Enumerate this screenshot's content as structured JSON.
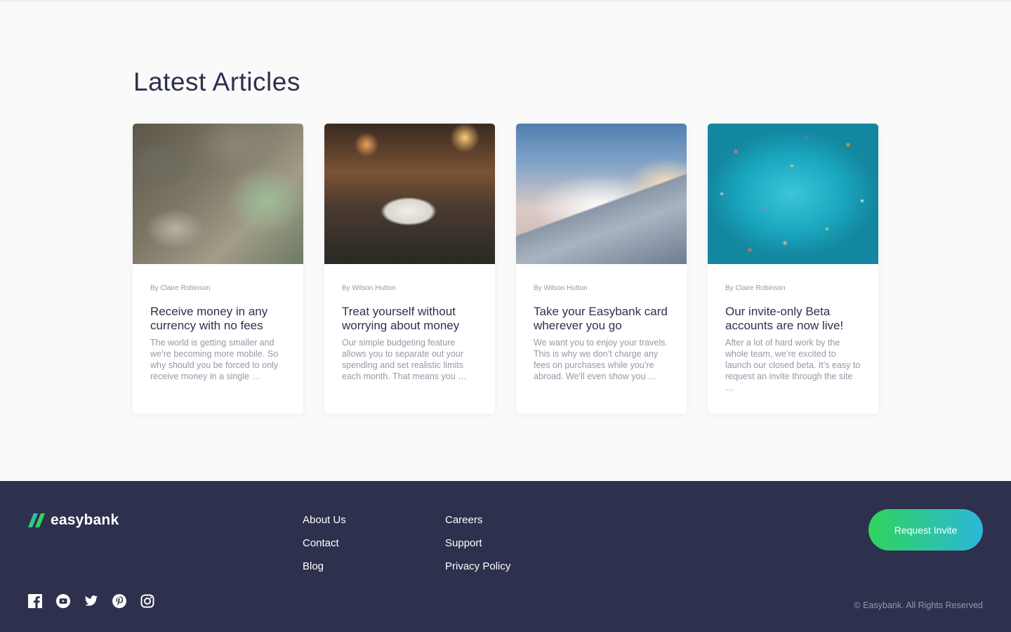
{
  "articles": {
    "title": "Latest Articles",
    "items": [
      {
        "author": "By Claire Robinson",
        "title": "Receive money in any currency with no fees",
        "excerpt": "The world is getting smaller and we’re becoming more mobile. So why should you be forced to only receive money in a single …",
        "image": "currency-notes-image"
      },
      {
        "author": "By Wilson Hutton",
        "title": "Treat yourself without worrying about money",
        "excerpt": "Our simple budgeting feature allows you to separate out your spending and set realistic limits each month. That means you …",
        "image": "restaurant-dinner-image"
      },
      {
        "author": "By Wilson Hutton",
        "title": "Take your Easybank card wherever you go",
        "excerpt": "We want you to enjoy your travels. This is why we don’t charge any fees on purchases while you’re abroad. We’ll even show you …",
        "image": "airplane-wing-image"
      },
      {
        "author": "By Claire Robinson",
        "title": "Our invite-only Beta accounts are now live!",
        "excerpt": "After a lot of hard work by the whole team, we’re excited to launch our closed beta. It’s easy to request an invite through the site …",
        "image": "confetti-image"
      }
    ]
  },
  "footer": {
    "logo_text": "easybank",
    "links_col1": [
      "About Us",
      "Contact",
      "Blog"
    ],
    "links_col2": [
      "Careers",
      "Support",
      "Privacy Policy"
    ],
    "cta_label": "Request Invite",
    "copyright": "© Easybank. All Rights Reserved",
    "social_icons": [
      "facebook-icon",
      "youtube-icon",
      "twitter-icon",
      "pinterest-icon",
      "instagram-icon"
    ]
  },
  "colors": {
    "page_bg": "#fafafa",
    "footer_bg": "#2d314d",
    "heading": "#2d314d",
    "muted": "#9698a6",
    "accent_green": "#31d35c",
    "accent_cyan": "#2bb7da"
  }
}
